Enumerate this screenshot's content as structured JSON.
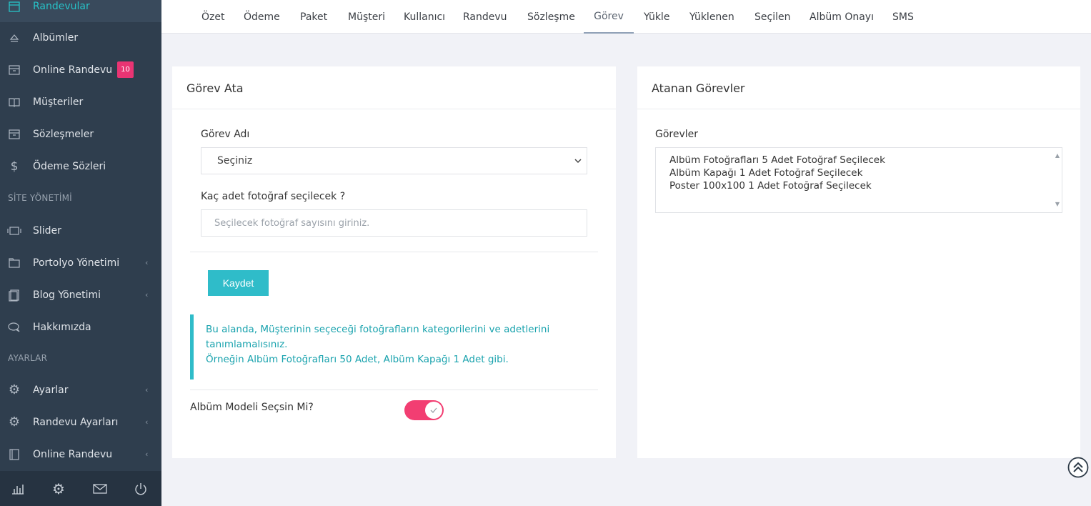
{
  "sidebar": {
    "items": [
      {
        "label": "Randevular",
        "icon": "calendar-icon"
      },
      {
        "label": "Albümler",
        "icon": "eject-icon"
      },
      {
        "label": "Online Randevu",
        "icon": "archive-icon",
        "badge": "10"
      },
      {
        "label": "Müşteriler",
        "icon": "book-icon"
      },
      {
        "label": "Sözleşmeler",
        "icon": "archive-icon"
      },
      {
        "label": "Ödeme Sözleri",
        "icon": "dollar-icon"
      },
      {
        "label": "Slider",
        "icon": "slider-icon"
      },
      {
        "label": "Portolyo Yönetimi",
        "icon": "folder-icon"
      },
      {
        "label": "Blog Yönetimi",
        "icon": "document-icon"
      },
      {
        "label": "Hakkımızda",
        "icon": "chat-icon"
      },
      {
        "label": "Ayarlar",
        "icon": "gear-icon"
      },
      {
        "label": "Randevu Ayarları",
        "icon": "gear-icon"
      },
      {
        "label": "Online Randevu",
        "icon": "notebook-icon"
      }
    ],
    "sections": {
      "site": "SİTE YÖNETİMİ",
      "settings": "AYARLAR"
    },
    "footer_icons": [
      "chart-icon",
      "gear-icon",
      "mail-icon",
      "power-icon"
    ]
  },
  "tabs": [
    "Özet",
    "Ödeme",
    "Paket",
    "Müşteri",
    "Kullanıcı",
    "Randevu",
    "Sözleşme",
    "Görev",
    "Yükle",
    "Yüklenen",
    "Seçilen",
    "Albüm Onayı",
    "SMS"
  ],
  "active_tab": "Görev",
  "assign": {
    "title": "Görev Ata",
    "task_label": "Görev Adı",
    "task_selected": "Seçiniz",
    "count_label": "Kaç adet fotoğraf seçilecek ?",
    "count_placeholder": "Seçilecek fotoğraf sayısını giriniz.",
    "save_label": "Kaydet",
    "info_line1": "Bu alanda, Müşterinin seçeceği fotoğrafların kategorilerini ve adetlerini tanımlamalısınız.",
    "info_line2": "Örneğin Albüm Fotoğrafları 50 Adet, Albüm Kapağı 1 Adet gibi.",
    "album_model_label": "Albüm Modeli Seçsin Mi?"
  },
  "assigned": {
    "title": "Atanan Görevler",
    "list_label": "Görevler",
    "tasks": [
      "Albüm Fotoğrafları 5 Adet Fotoğraf Seçilecek",
      "Albüm Kapağı 1 Adet Fotoğraf Seçilecek",
      "Poster 100x100 1 Adet Fotoğraf Seçilecek"
    ]
  },
  "colors": {
    "accent": "#2fbcc9",
    "toggle": "#f23e72",
    "badge": "#e93473",
    "sidebar": "#2f3e4e"
  }
}
